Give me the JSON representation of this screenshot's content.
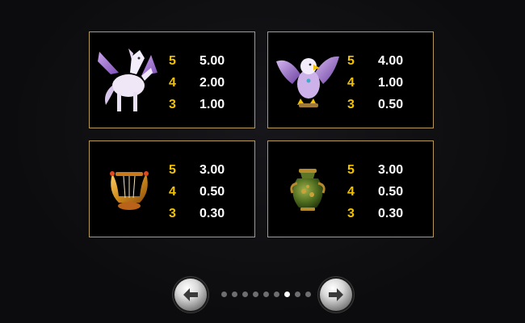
{
  "paytable": [
    {
      "symbol": "pegasus-icon",
      "payouts": [
        {
          "count": "5",
          "value": "5.00"
        },
        {
          "count": "4",
          "value": "2.00"
        },
        {
          "count": "3",
          "value": "1.00"
        }
      ]
    },
    {
      "symbol": "eagle-icon",
      "payouts": [
        {
          "count": "5",
          "value": "4.00"
        },
        {
          "count": "4",
          "value": "1.00"
        },
        {
          "count": "3",
          "value": "0.50"
        }
      ]
    },
    {
      "symbol": "lyre-icon",
      "payouts": [
        {
          "count": "5",
          "value": "3.00"
        },
        {
          "count": "4",
          "value": "0.50"
        },
        {
          "count": "3",
          "value": "0.30"
        }
      ]
    },
    {
      "symbol": "vase-icon",
      "payouts": [
        {
          "count": "5",
          "value": "3.00"
        },
        {
          "count": "4",
          "value": "0.50"
        },
        {
          "count": "3",
          "value": "0.30"
        }
      ]
    }
  ],
  "pagination": {
    "total_pages": 9,
    "current_page": 7
  },
  "colors": {
    "frame": "#b89a58",
    "count_text": "#f2c200",
    "value_text": "#ffffff"
  },
  "nav": {
    "prev_icon": "arrow-left-icon",
    "next_icon": "arrow-right-icon"
  }
}
